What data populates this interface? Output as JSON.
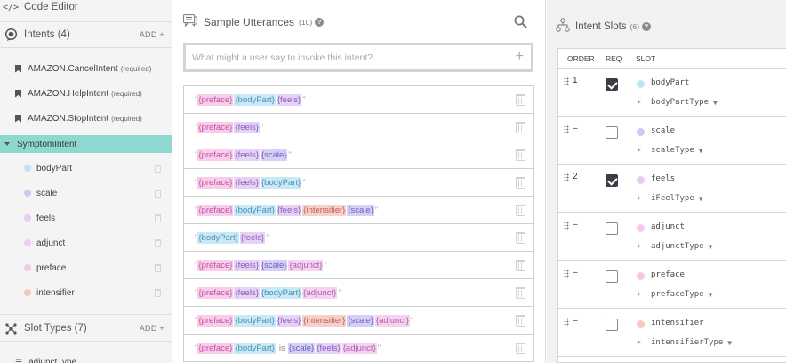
{
  "sidebar": {
    "code_editor": "Code Editor",
    "intents_header": "Intents (4)",
    "intents_add": "ADD +",
    "builtin_intents": [
      {
        "name": "AMAZON.CancelIntent",
        "req": "(required)"
      },
      {
        "name": "AMAZON.HelpIntent",
        "req": "(required)"
      },
      {
        "name": "AMAZON.StopIntent",
        "req": "(required)"
      }
    ],
    "selected_intent": "SymptomIntent",
    "intent_slots": [
      {
        "name": "bodyPart",
        "color": "#bfe4f6"
      },
      {
        "name": "scale",
        "color": "#cfc9f4"
      },
      {
        "name": "feels",
        "color": "#e7cdf4"
      },
      {
        "name": "adjunct",
        "color": "#f6c9ee"
      },
      {
        "name": "preface",
        "color": "#f6c7e6"
      },
      {
        "name": "intensifier",
        "color": "#f6c8c2"
      }
    ],
    "slot_types_header": "Slot Types (7)",
    "slot_types_add": "ADD +",
    "slot_types": [
      "adjunctType"
    ]
  },
  "utterances": {
    "title": "Sample Utterances",
    "count": "(10)",
    "help": "?",
    "input_placeholder": "What might a user say to invoke this intent?",
    "add_symbol": "+",
    "rows": [
      [
        {
          "t": "slot",
          "v": "preface"
        },
        {
          "t": "slot",
          "v": "bodyPart"
        },
        {
          "t": "slot",
          "v": "feels"
        }
      ],
      [
        {
          "t": "slot",
          "v": "preface"
        },
        {
          "t": "slot",
          "v": "feels"
        }
      ],
      [
        {
          "t": "slot",
          "v": "preface"
        },
        {
          "t": "slot",
          "v": "feels"
        },
        {
          "t": "slot",
          "v": "scale"
        }
      ],
      [
        {
          "t": "slot",
          "v": "preface"
        },
        {
          "t": "slot",
          "v": "feels"
        },
        {
          "t": "slot",
          "v": "bodyPart"
        }
      ],
      [
        {
          "t": "slot",
          "v": "preface"
        },
        {
          "t": "slot",
          "v": "bodyPart"
        },
        {
          "t": "slot",
          "v": "feels"
        },
        {
          "t": "slot",
          "v": "intensifier"
        },
        {
          "t": "slot",
          "v": "scale"
        }
      ],
      [
        {
          "t": "slot",
          "v": "bodyPart"
        },
        {
          "t": "slot",
          "v": "feels"
        }
      ],
      [
        {
          "t": "slot",
          "v": "preface"
        },
        {
          "t": "slot",
          "v": "feels"
        },
        {
          "t": "slot",
          "v": "scale"
        },
        {
          "t": "slot",
          "v": "adjunct"
        }
      ],
      [
        {
          "t": "slot",
          "v": "preface"
        },
        {
          "t": "slot",
          "v": "feels"
        },
        {
          "t": "slot",
          "v": "bodyPart"
        },
        {
          "t": "slot",
          "v": "adjunct"
        }
      ],
      [
        {
          "t": "slot",
          "v": "preface"
        },
        {
          "t": "slot",
          "v": "bodyPart"
        },
        {
          "t": "slot",
          "v": "feels"
        },
        {
          "t": "slot",
          "v": "intensifier"
        },
        {
          "t": "slot",
          "v": "scale"
        },
        {
          "t": "slot",
          "v": "adjunct"
        }
      ],
      [
        {
          "t": "slot",
          "v": "preface"
        },
        {
          "t": "slot",
          "v": "bodyPart"
        },
        {
          "t": "text",
          "v": "is"
        },
        {
          "t": "slot",
          "v": "scale"
        },
        {
          "t": "slot",
          "v": "feels"
        },
        {
          "t": "slot",
          "v": "adjunct"
        }
      ]
    ]
  },
  "slots": {
    "title": "Intent Slots",
    "count": "(6)",
    "help": "?",
    "headers": {
      "order": "ORDER",
      "req": "REQ",
      "slot": "SLOT"
    },
    "rows": [
      {
        "order": "1",
        "required": true,
        "name": "bodyPart",
        "type": "bodyPartType",
        "color": "#bfe4f6"
      },
      {
        "order": "–",
        "required": false,
        "name": "scale",
        "type": "scaleType",
        "color": "#cfc9f4"
      },
      {
        "order": "2",
        "required": true,
        "name": "feels",
        "type": "iFeelType",
        "color": "#e7cdf4"
      },
      {
        "order": "–",
        "required": false,
        "name": "adjunct",
        "type": "adjunctType",
        "color": "#f6c9ee"
      },
      {
        "order": "–",
        "required": false,
        "name": "preface",
        "type": "prefaceType",
        "color": "#f6c7e6"
      },
      {
        "order": "–",
        "required": false,
        "name": "intensifier",
        "type": "intensifierType",
        "color": "#f6c8c2"
      }
    ]
  }
}
